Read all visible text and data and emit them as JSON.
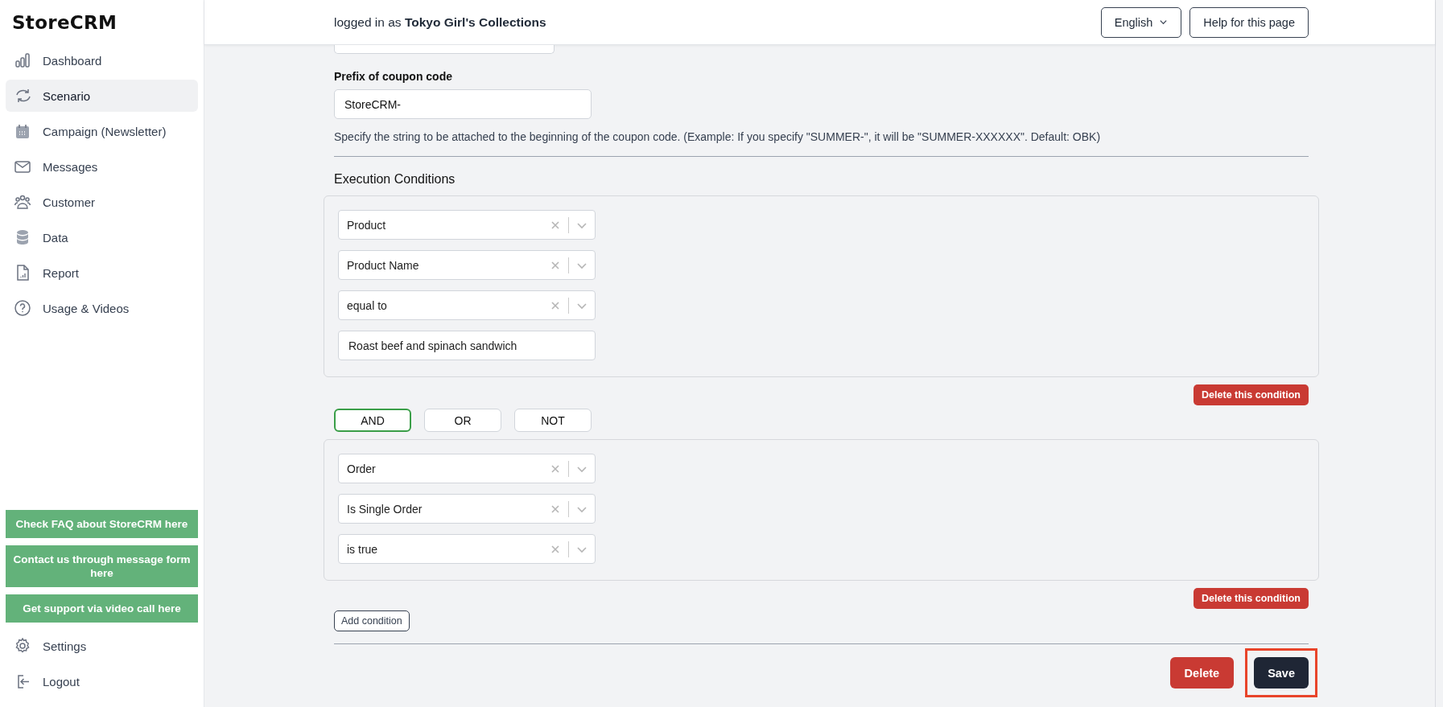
{
  "sidebar": {
    "logo": "StoreCRM",
    "nav": [
      {
        "label": "Dashboard",
        "kind": "dashboard",
        "selected": false
      },
      {
        "label": "Scenario",
        "kind": "scenario",
        "selected": true
      },
      {
        "label": "Campaign (Newsletter)",
        "kind": "campaign",
        "selected": false
      },
      {
        "label": "Messages",
        "kind": "messages",
        "selected": false
      },
      {
        "label": "Customer",
        "kind": "customer",
        "selected": false
      },
      {
        "label": "Data",
        "kind": "data",
        "selected": false
      },
      {
        "label": "Report",
        "kind": "report",
        "selected": false
      },
      {
        "label": "Usage & Videos",
        "kind": "usage",
        "selected": false
      }
    ],
    "help_links": [
      "Check FAQ about StoreCRM here",
      "Contact us through message form here",
      "Get support via video call here"
    ],
    "footer_nav": [
      {
        "label": "Settings",
        "kind": "settings",
        "selected": false
      },
      {
        "label": "Logout",
        "kind": "logout",
        "selected": false
      }
    ]
  },
  "header": {
    "login_text": "logged in as **Tokyo Girl's Collections**",
    "language": "English",
    "help_button": "Help for this page"
  },
  "form": {
    "coupon_prefix": {
      "label": "Prefix of coupon code",
      "value": "StoreCRM-",
      "help": "Specify the string to be attached to the beginning of the coupon code. (Example: If you specify \"SUMMER-\", it will be \"SUMMER-XXXXXX\". Default: OBK)"
    },
    "section_title": "Execution Conditions",
    "condition_groups": [
      {
        "fields": [
          {
            "kind": "select",
            "value": "Product"
          },
          {
            "kind": "select",
            "value": "Product Name"
          },
          {
            "kind": "select",
            "value": "equal to"
          },
          {
            "kind": "text",
            "value": "Roast beef and spinach sandwich"
          }
        ],
        "delete_button": "Delete this condition"
      },
      {
        "fields": [
          {
            "kind": "select",
            "value": "Order"
          },
          {
            "kind": "select",
            "value": "Is Single Order"
          },
          {
            "kind": "select",
            "value": "is true"
          }
        ],
        "delete_button": "Delete this condition"
      }
    ],
    "operators": [
      {
        "label": "AND",
        "selected": true
      },
      {
        "label": "OR",
        "selected": false
      },
      {
        "label": "NOT",
        "selected": false
      }
    ],
    "add_button": "Add condition",
    "actions": {
      "delete": "Delete",
      "save": "Save",
      "save_highlighted": true
    }
  }
}
